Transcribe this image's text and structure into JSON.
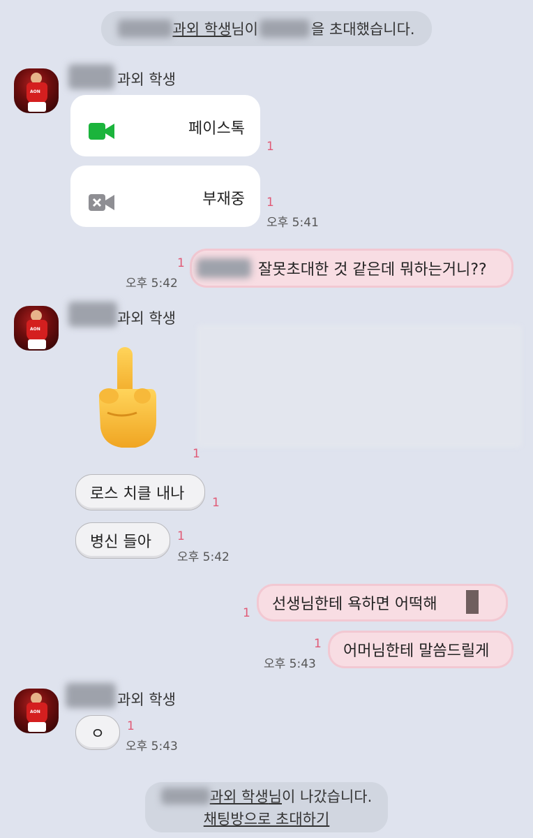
{
  "invite_notice": {
    "name_mid": "과외 학생",
    "name_suffix": "님이",
    "text_tail": "을 초대했습니다."
  },
  "sender_name": "과외 학생",
  "messages": {
    "facetime_label": "페이스톡",
    "missed_label": "부재중",
    "read_count": "1",
    "time_541": "오후 5:41",
    "my_msg1": "잘못초대한 것 같은데 뭐하는거니??",
    "time_542a": "오후 5:42",
    "reply1": "로스 치클 내나",
    "reply2": "병신 들아",
    "time_542b": "오후 5:42",
    "my_msg2": "선생님한테 욕하면 어떡해",
    "my_msg3": "어머님한테 말씀드릴게",
    "time_543a": "오후 5:43",
    "reply3": "ㅇ",
    "time_543b": "오후 5:43"
  },
  "leave_notice": {
    "name": "과외 학생",
    "suffix": "님",
    "text": "이 나갔습니다.",
    "invite_link": "채팅방으로 초대하기"
  },
  "icons": {
    "facetime": "video-camera-icon",
    "missed": "missed-video-icon",
    "emoji": "middle-finger-emoji"
  }
}
